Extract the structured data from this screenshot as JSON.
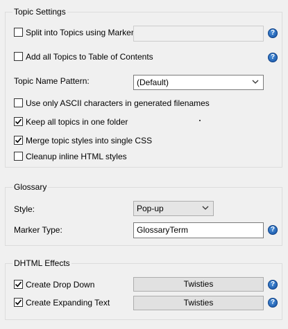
{
  "topic_settings": {
    "title": "Topic Settings",
    "split_label": "Split into Topics using Marker:",
    "split_checked": false,
    "split_marker_value": "",
    "add_toc_label": "Add all Topics to Table of Contents",
    "add_toc_checked": false,
    "name_pattern_label": "Topic Name Pattern:",
    "name_pattern_value": "(Default)",
    "ascii_label": "Use only ASCII characters in generated filenames",
    "ascii_checked": false,
    "keep_folder_label": "Keep all topics in one folder",
    "keep_folder_checked": true,
    "merge_css_label": "Merge topic styles into single CSS",
    "merge_css_checked": true,
    "cleanup_label": "Cleanup inline HTML styles",
    "cleanup_checked": false
  },
  "glossary": {
    "title": "Glossary",
    "style_label": "Style:",
    "style_value": "Pop-up",
    "marker_type_label": "Marker Type:",
    "marker_type_value": "GlossaryTerm"
  },
  "dhtml": {
    "title": "DHTML Effects",
    "drop_down_label": "Create Drop Down",
    "drop_down_checked": true,
    "drop_down_button": "Twisties",
    "expanding_label": "Create Expanding Text",
    "expanding_checked": true,
    "expanding_button": "Twisties"
  },
  "help_glyph": "?",
  "colors": {
    "help_blue": "#1553a6",
    "group_border": "#dcdcdc",
    "window_bg": "#f0f0f0"
  }
}
